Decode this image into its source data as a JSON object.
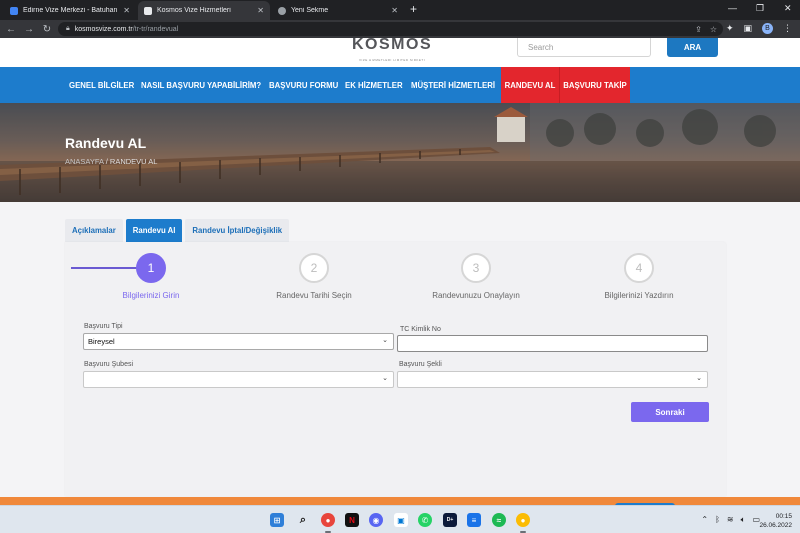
{
  "browser": {
    "tabs": [
      {
        "title": "Edirne Vize Merkezi - Batuhan - G",
        "icon": "docs-icon",
        "color": "#4285f4"
      },
      {
        "title": "Kosmos Vize Hizmetleri",
        "icon": "kosmos-favicon",
        "color": "#e8eaed"
      },
      {
        "title": "Yeni Sekme",
        "icon": "chrome-icon",
        "color": "#9aa0a6"
      }
    ],
    "address_domain": "kosmosvize.com.tr",
    "address_path": "/tr-tr/randevual",
    "profile_initial": "B"
  },
  "site": {
    "logo_text": "KOSMOS",
    "logo_tagline": "VIZE HIZMETLERI LIMITED SIRKETI",
    "search_placeholder": "Search",
    "search_button": "ARA",
    "nav": [
      "GENEL BİLGİLER",
      "NASIL BAŞVURU YAPABİLİRİM?",
      "BAŞVURU FORMU",
      "EK HİZMETLER",
      "MÜŞTERİ HİZMETLERİ",
      "RANDEVU AL",
      "BAŞVURU TAKİP"
    ],
    "accent_color": "#1d7ccc",
    "highlight_color": "#e3262d"
  },
  "hero": {
    "title": "Randevu AL",
    "breadcrumb_home": "ANASAYFA",
    "breadcrumb_sep": "/",
    "breadcrumb_current": "RANDEVU AL"
  },
  "page_tabs": [
    "Açıklamalar",
    "Randevu Al",
    "Randevu İptal/Değişiklik"
  ],
  "wizard": {
    "steps": [
      {
        "num": "1",
        "label": "Bilgilerinizi Girin",
        "active": true
      },
      {
        "num": "2",
        "label": "Randevu Tarihi Seçin",
        "active": false
      },
      {
        "num": "3",
        "label": "Randevunuzu Onaylayın",
        "active": false
      },
      {
        "num": "4",
        "label": "Bilgilerinizi Yazdırın",
        "active": false
      }
    ],
    "step_color": "#7b68ee"
  },
  "form": {
    "application_type_label": "Başvuru Tipi",
    "application_type_value": "Bireysel",
    "tc_label": "TC Kimlik No",
    "tc_value": "",
    "branch_label": "Başvuru Şubesi",
    "branch_value": "",
    "method_label": "Başvuru Şekli",
    "method_value": "",
    "next_button": "Sonraki"
  },
  "taskbar": {
    "time": "00:15",
    "date": "26.06.2022"
  }
}
